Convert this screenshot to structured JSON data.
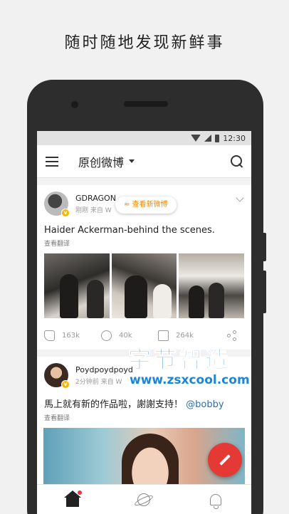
{
  "promo": {
    "headline": "随时随地发现新鲜事"
  },
  "statusbar": {
    "time": "12:30"
  },
  "appbar": {
    "title": "原创微博"
  },
  "banner": {
    "new_posts_pill": "≈ 查看新微博"
  },
  "posts": [
    {
      "username": "GDRAGON",
      "time_source": "刚刚 来自 W",
      "text": "Haider Ackerman-behind the scenes.",
      "translate": "查看翻译",
      "likes": "163k",
      "comments": "40k",
      "reposts": "264k"
    },
    {
      "username": "Poydpoydpoyd",
      "time_source": "2分钟前 来自 W",
      "text": "馬上就有新的作品啦，謝謝支持！",
      "mention": "@bobby",
      "translate": "查看翻译"
    }
  ],
  "watermark": {
    "name": "字节智造",
    "url": "www.zsxcool.com"
  },
  "icons": {
    "menu": "hamburger-icon",
    "search": "search-icon",
    "like": "thumb-up-icon",
    "comment": "comment-icon",
    "repost": "repost-icon",
    "share": "share-icon",
    "compose": "pencil-icon",
    "home": "home-icon",
    "discover": "planet-icon",
    "notifications": "bell-icon"
  },
  "colors": {
    "accent": "#e53935",
    "pill_text": "#f08a00",
    "mention": "#2a6ea8",
    "verified": "#f7b500"
  }
}
